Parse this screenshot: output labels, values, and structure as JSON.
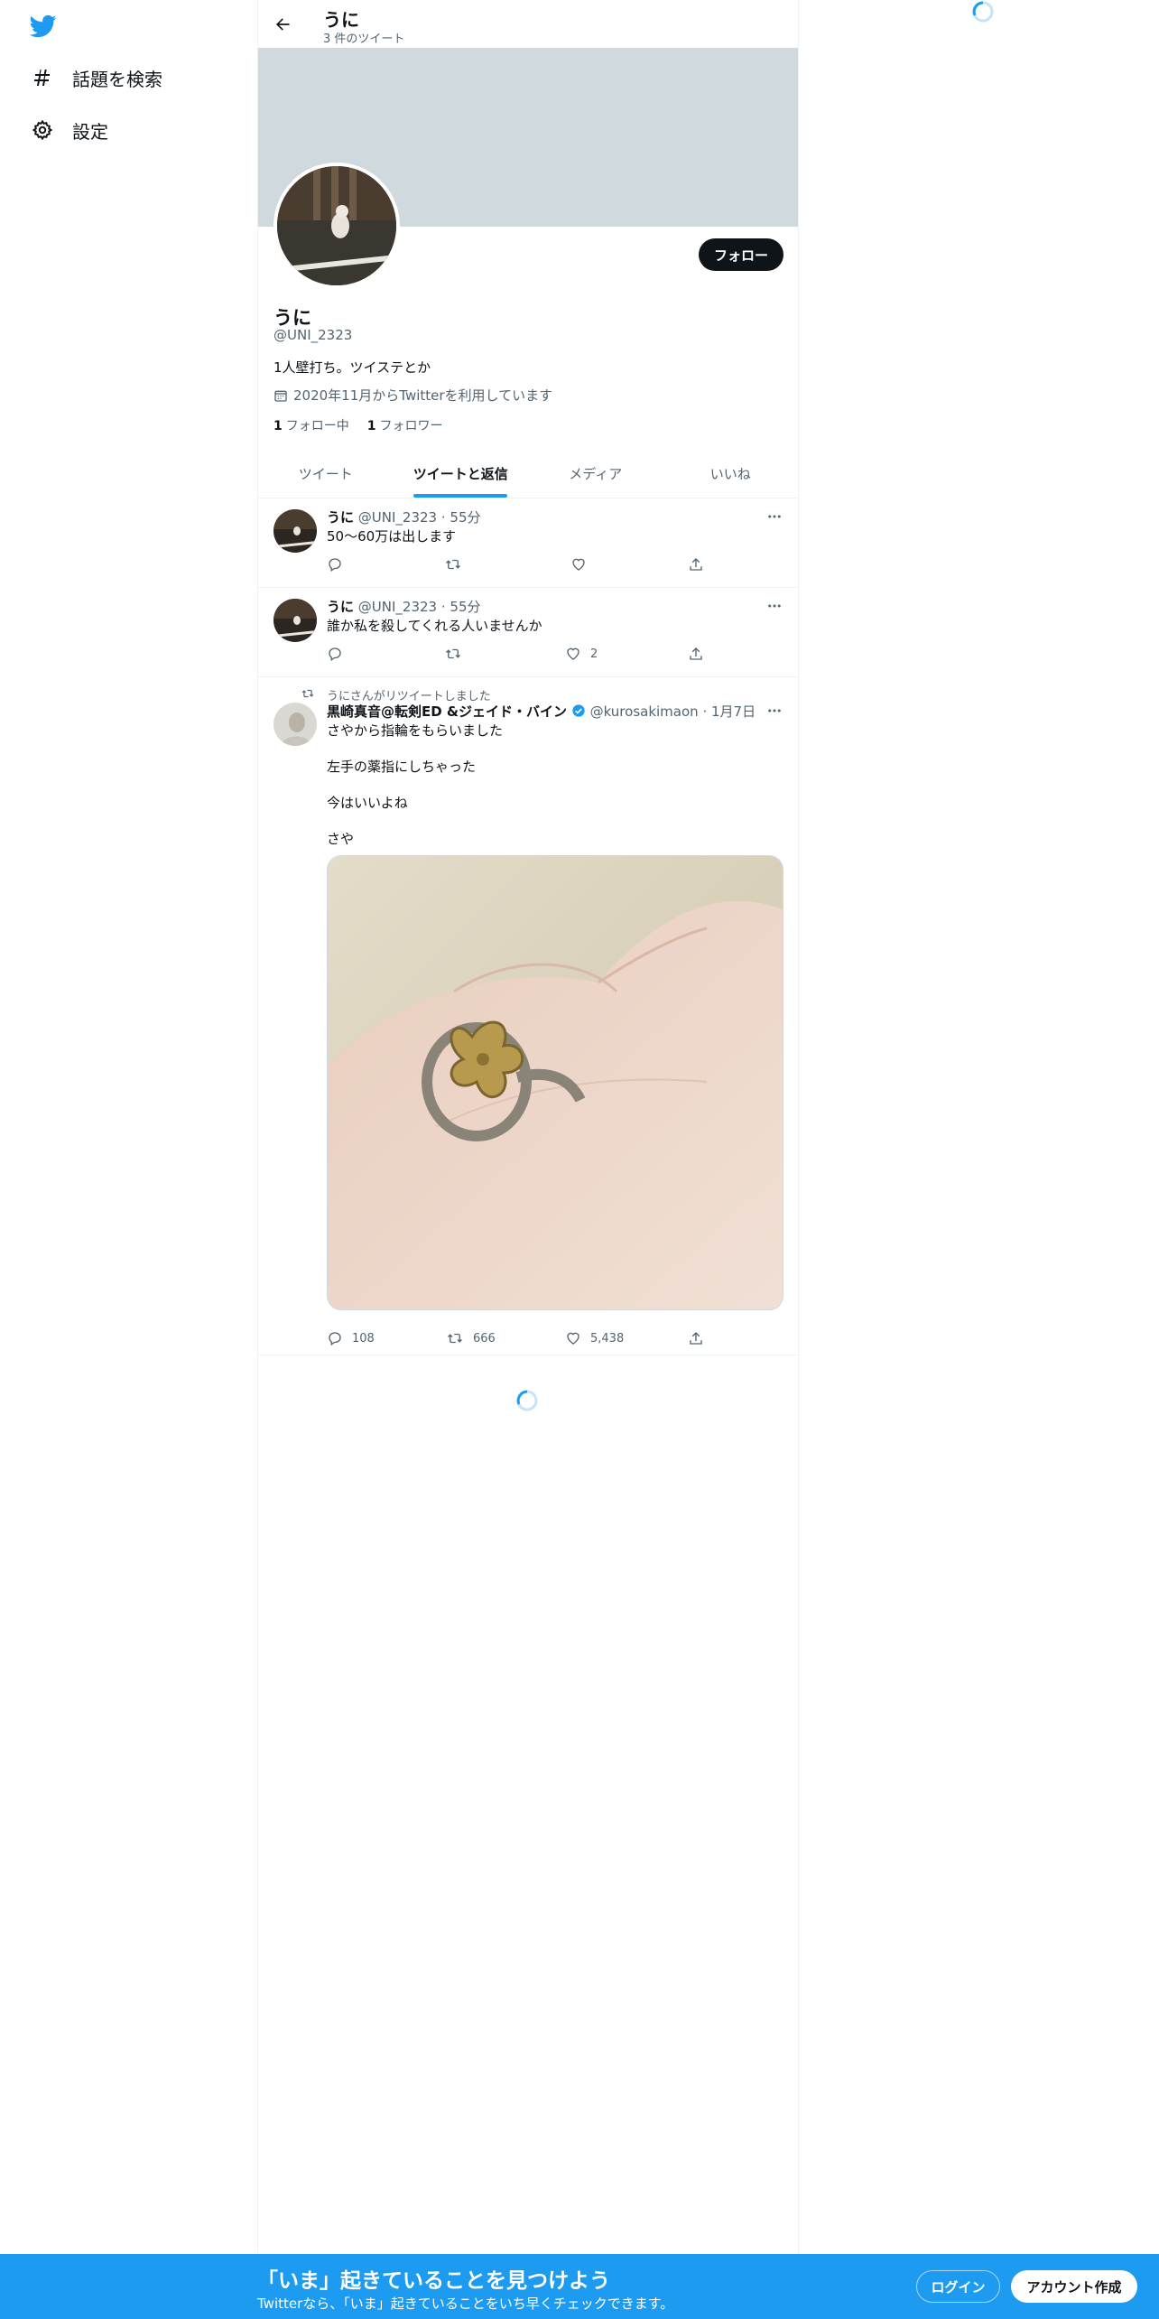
{
  "nav": {
    "explore_label": "話題を検索",
    "settings_label": "設定"
  },
  "profile": {
    "name": "うに",
    "tweet_count": "3 件のツイート",
    "handle": "@UNI_2323",
    "bio": "1人壁打ち。ツイステとか",
    "joined": "2020年11月からTwitterを利用しています",
    "following_count": "1",
    "following_label": "フォロー中",
    "followers_count": "1",
    "followers_label": "フォロワー",
    "follow_button": "フォロー"
  },
  "tabs": [
    {
      "label": "ツイート"
    },
    {
      "label": "ツイートと返信"
    },
    {
      "label": "メディア"
    },
    {
      "label": "いいね"
    }
  ],
  "tweets": [
    {
      "name": "うに",
      "handle": "@UNI_2323",
      "time": "55分",
      "text": "50〜60万は出します",
      "replies": "",
      "retweets": "",
      "likes": ""
    },
    {
      "name": "うに",
      "handle": "@UNI_2323",
      "time": "55分",
      "text": "誰か私を殺してくれる人いませんか",
      "replies": "",
      "retweets": "",
      "likes": "2"
    },
    {
      "retweeted_by": "うにさんがリツイートしました",
      "name": "黒崎真音@転剣ED &ジェイド・バイン",
      "handle": "@kurosakimaon",
      "time": "1月7日",
      "text": "さやから指輪をもらいました\n\n左手の薬指にしちゃった\n\n今はいいよね\n\nさや",
      "replies": "108",
      "retweets": "666",
      "likes": "5,438"
    }
  ],
  "bottom_bar": {
    "title": "「いま」起きていることを見つけよう",
    "subtitle": "Twitterなら、「いま」起きていることをいち早くチェックできます。",
    "login": "ログイン",
    "signup": "アカウント作成"
  },
  "colors": {
    "accent": "#1d9bf0",
    "banner": "#cfd9de",
    "text_primary": "#0f1419",
    "text_secondary": "#536471"
  },
  "icons": [
    "twitter-logo-icon",
    "hashtag-icon",
    "gear-icon",
    "back-arrow-icon",
    "calendar-icon",
    "reply-icon",
    "retweet-icon",
    "like-icon",
    "share-icon",
    "more-icon",
    "verified-icon",
    "loading-spinner-icon"
  ]
}
